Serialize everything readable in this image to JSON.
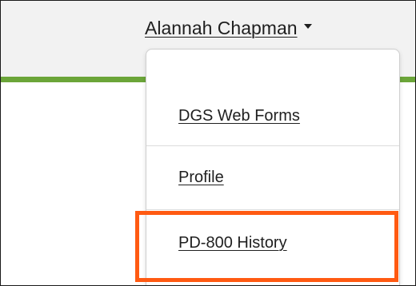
{
  "user_menu": {
    "username": "Alannah Chapman",
    "caret_icon": "caret-down-icon",
    "items": [
      {
        "label": "DGS Web Forms"
      },
      {
        "label": "Profile"
      },
      {
        "label": "PD-800 History"
      }
    ]
  },
  "colors": {
    "header_background": "#f2f2f2",
    "accent_rule": "#6ba539",
    "highlight": "#ff5a12",
    "text": "#1f1f1f"
  }
}
